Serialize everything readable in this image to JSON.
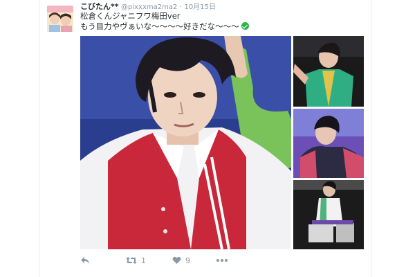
{
  "tweet": {
    "display_name": "こびたん**",
    "handle": "@pixxxma2ma2",
    "separator": "·",
    "date": "10月15日",
    "line1": "松倉くんジャニフワ梅田ver",
    "line2": "もう目力やヴぁいな〜〜〜〜好きだな〜〜〜",
    "emoji_icon": "green-check-emoji-icon"
  },
  "actions": {
    "reply_icon": "reply-icon",
    "retweet_icon": "retweet-icon",
    "retweet_count": "1",
    "like_icon": "heart-icon",
    "like_count": "9",
    "more_icon": "more-dots-icon"
  },
  "colors": {
    "text": "#292f33",
    "muted": "#8899a6",
    "check": "#2fb34a",
    "vest": "#c9283b",
    "stage_blue": "#2a3d8e"
  }
}
